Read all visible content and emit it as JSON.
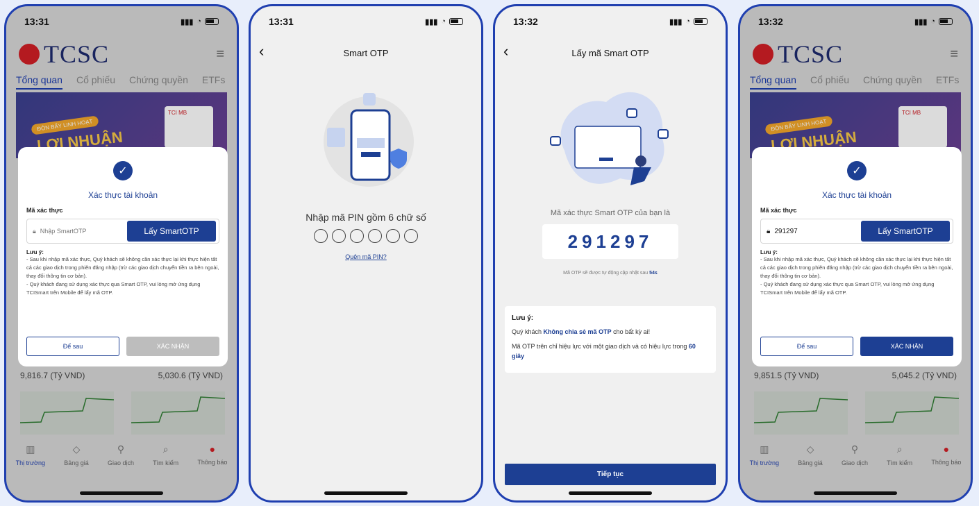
{
  "colors": {
    "primary": "#1d3f93",
    "frame": "#1f3fb0",
    "brand_red": "#d21f26",
    "disabled": "#bdbdbd"
  },
  "screen1": {
    "time": "13:31",
    "logo": "TCSC",
    "tabs": [
      "Tổng quan",
      "Cổ phiếu",
      "Chứng quyền",
      "ETFs"
    ],
    "figures": [
      "9,816.7 (Tỷ VND)",
      "5,030.6 (Tỷ VND)"
    ],
    "modal": {
      "title": "Xác thực tài khoản",
      "field_label": "Mã xác thực",
      "placeholder": "Nhập SmartOTP",
      "get_button": "Lấy SmartOTP",
      "note_title": "Lưu ý:",
      "note_1": "- Sau khi nhập mã xác thực, Quý khách sẽ không cần xác thực lại khi thực hiện tất cả các giao dịch trong phiên đăng nhập (trừ các giao dịch chuyển tiền ra bên ngoài, thay đổi thông tin cơ bản).",
      "note_2": "- Quý khách đang sử dụng xác thực qua Smart OTP, vui lòng mở ứng dụng TCISmart trên Mobile để lấy mã OTP.",
      "later": "Để sau",
      "confirm": "XÁC NHẬN"
    },
    "nav": [
      "Thị trường",
      "Bảng giá",
      "Giao dịch",
      "Tìm kiếm",
      "Thông báo"
    ]
  },
  "screen2": {
    "time": "13:31",
    "title": "Smart OTP",
    "pin_prompt": "Nhập mã PIN gồm 6 chữ số",
    "forgot": "Quên mã PIN?"
  },
  "screen3": {
    "time": "13:32",
    "title": "Lấy mã Smart OTP",
    "otp_label": "Mã xác thực Smart OTP của bạn là",
    "otp_code": "291297",
    "refresh_prefix": "Mã OTP sẽ được tự động cập nhật sau",
    "refresh_seconds": "54s",
    "note_title": "Lưu ý:",
    "note_line1_a": "Quý khách",
    "note_line1_b": "Không chia sẻ mã OTP",
    "note_line1_c": "cho bất kỳ ai!",
    "note_line2_a": "Mã OTP trên chỉ hiệu lực với một giao dịch và có hiệu lực trong",
    "note_line2_b": "60 giây",
    "continue": "Tiếp tục"
  },
  "screen4": {
    "time": "13:32",
    "logo": "TCSC",
    "tabs": [
      "Tổng quan",
      "Cổ phiếu",
      "Chứng quyền",
      "ETFs"
    ],
    "figures": [
      "9,851.5 (Tỷ VND)",
      "5,045.2 (Tỷ VND)"
    ],
    "modal": {
      "title": "Xác thực tài khoản",
      "field_label": "Mã xác thực",
      "value": "291297",
      "get_button": "Lấy SmartOTP",
      "note_title": "Lưu ý:",
      "note_1": "- Sau khi nhập mã xác thực, Quý khách sẽ không cần xác thực lại khi thực hiện tất cả các giao dịch trong phiên đăng nhập (trừ các giao dịch chuyển tiền ra bên ngoài, thay đổi thông tin cơ bản).",
      "note_2": "- Quý khách đang sử dụng xác thực qua Smart OTP, vui lòng mở ứng dụng TCISmart trên Mobile để lấy mã OTP.",
      "later": "Để sau",
      "confirm": "XÁC NHẬN"
    },
    "nav": [
      "Thị trường",
      "Bảng giá",
      "Giao dịch",
      "Tìm kiếm",
      "Thông báo"
    ]
  }
}
